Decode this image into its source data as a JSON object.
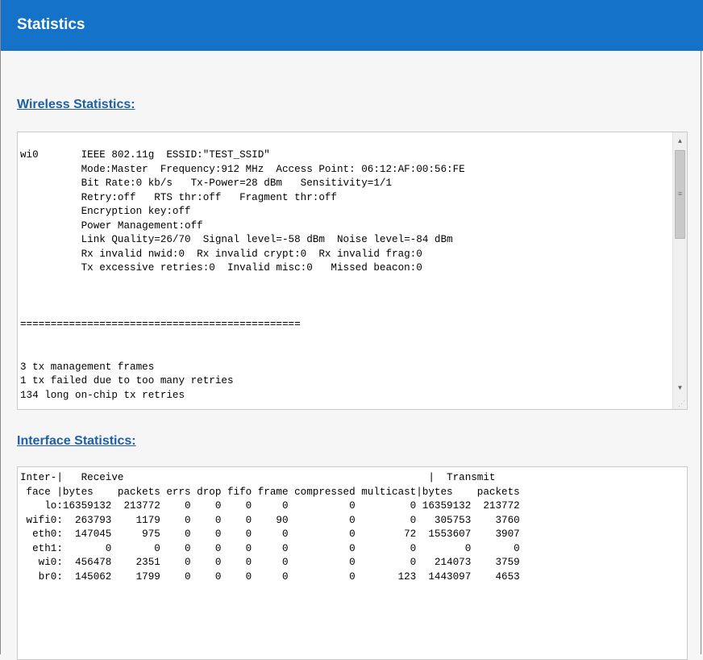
{
  "window": {
    "title": "Statistics"
  },
  "wireless": {
    "heading": "Wireless Statistics:",
    "lines": [
      "wi0       IEEE 802.11g  ESSID:\"TEST_SSID\"",
      "          Mode:Master  Frequency:912 MHz  Access Point: 06:12:AF:00:56:FE",
      "          Bit Rate:0 kb/s   Tx-Power=28 dBm   Sensitivity=1/1",
      "          Retry:off   RTS thr:off   Fragment thr:off",
      "          Encryption key:off",
      "          Power Management:off",
      "          Link Quality=26/70  Signal level=-58 dBm  Noise level=-84 dBm",
      "          Rx invalid nwid:0  Rx invalid crypt:0  Rx invalid frag:0",
      "          Tx excessive retries:0  Invalid misc:0   Missed beacon:0",
      "",
      "",
      "",
      "==============================================",
      "",
      "",
      "3 tx management frames",
      "1 tx failed due to too many retries",
      "134 long on-chip tx retries"
    ]
  },
  "interface": {
    "heading": "Interface Statistics:",
    "lines": [
      "Inter-|   Receive                                                  |  Transmit",
      " face |bytes    packets errs drop fifo frame compressed multicast|bytes    packets",
      "    lo:16359132  213772    0    0    0     0          0         0 16359132  213772",
      " wifi0:  263793    1179    0    0    0    90          0         0   305753    3760",
      "  eth0:  147045     975    0    0    0     0          0        72  1553607    3907",
      "  eth1:       0       0    0    0    0     0          0         0        0       0",
      "   wi0:  456478    2351    0    0    0     0          0         0   214073    3759",
      "   br0:  145062    1799    0    0    0     0          0       123  1443097    4653"
    ]
  }
}
